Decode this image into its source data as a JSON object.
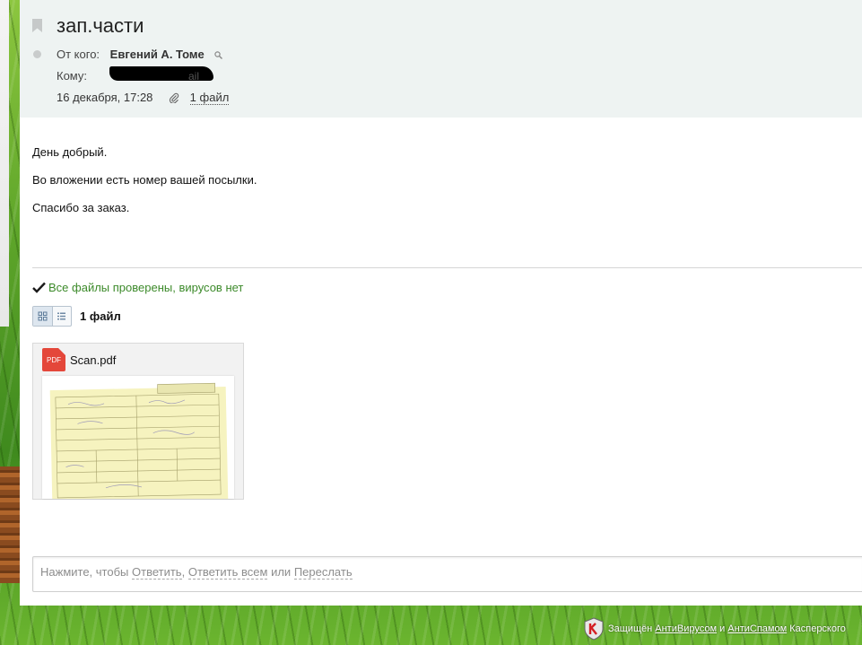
{
  "email": {
    "subject": "зап.части",
    "from_label": "От кого:",
    "from_name": "Евгений А. Томе",
    "to_label": "Кому:",
    "to_visible_fragment": "ail",
    "date": "16 декабря, 17:28",
    "files_link": "1 файл"
  },
  "body": {
    "paragraphs": [
      "День добрый.",
      "Во вложении есть номер вашей посылки.",
      "Спасибо за заказ."
    ]
  },
  "attachments": {
    "virus_status": "Все файлы проверены, вирусов нет",
    "count_label": "1 файл",
    "files": [
      {
        "name": "Scan.pdf",
        "icon_label": "PDF"
      }
    ]
  },
  "reply": {
    "prefix": "Нажмите, чтобы",
    "reply": "Ответить",
    "sep1": ",",
    "reply_all": "Ответить всем",
    "or": "или",
    "forward": "Переслать"
  },
  "footer": {
    "protected": "Защищён",
    "antivirus": "АнтиВирусом",
    "and": "и",
    "antispam": "АнтиСпамом",
    "brand": "Касперского"
  },
  "colors": {
    "header_bg": "#eef3f2",
    "virus_ok": "#3c8a2a",
    "pdf_red": "#e4473a"
  },
  "icons": [
    "bookmark-icon",
    "search-icon",
    "paperclip-icon",
    "check-icon",
    "grid-view-icon",
    "list-view-icon",
    "pdf-icon",
    "kaspersky-shield-icon"
  ]
}
